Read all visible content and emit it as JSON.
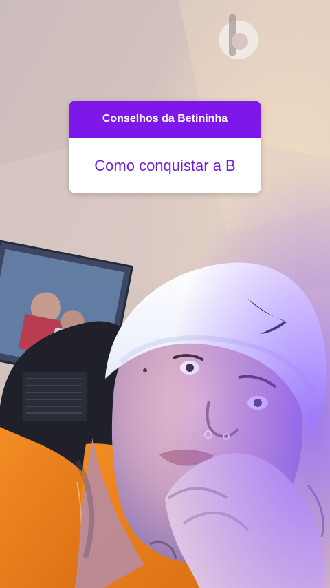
{
  "question_sticker": {
    "prompt": "Conselhos da Betininha",
    "answer": "Como conquistar a B"
  }
}
